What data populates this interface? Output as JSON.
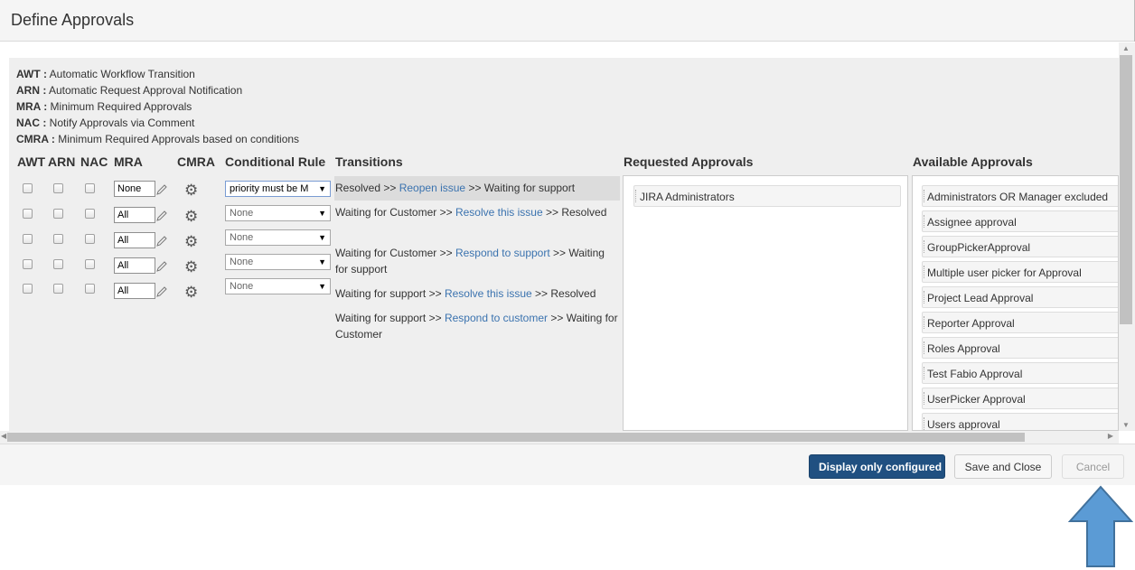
{
  "dialog": {
    "title": "Define Approvals"
  },
  "legend": [
    {
      "abbr": "AWT :",
      "text": " Automatic Workflow Transition"
    },
    {
      "abbr": "ARN :",
      "text": " Automatic Request Approval Notification"
    },
    {
      "abbr": "MRA :",
      "text": " Minimum Required Approvals"
    },
    {
      "abbr": "NAC :",
      "text": " Notify Approvals via Comment"
    },
    {
      "abbr": "CMRA :",
      "text": " Minimum Required Approvals based on conditions"
    }
  ],
  "columns": {
    "awt": "AWT",
    "arn": "ARN",
    "nac": "NAC",
    "mra": "MRA",
    "cmra": "CMRA",
    "conditional_rule": "Conditional Rule",
    "transitions": "Transitions",
    "requested": "Requested Approvals",
    "available": "Available Approvals"
  },
  "rows": [
    {
      "mra": "None",
      "rule": "priority must be M"
    },
    {
      "mra": "All",
      "rule": "None"
    },
    {
      "mra": "All",
      "rule": "None"
    },
    {
      "mra": "All",
      "rule": "None"
    },
    {
      "mra": "All",
      "rule": "None"
    }
  ],
  "transitions": [
    {
      "from": "Resolved >> ",
      "link": "Reopen issue",
      "to": " >> Waiting for support",
      "selected": true
    },
    {
      "from": "Waiting for Customer >> ",
      "link": "Resolve this issue",
      "to": " >> Resolved"
    },
    {
      "from": "Waiting for Customer >> ",
      "link": "Respond to support",
      "to": " >> Waiting for support"
    },
    {
      "from": "Waiting for support >> ",
      "link": "Resolve this issue",
      "to": " >> Resolved"
    },
    {
      "from": "Waiting for support >> ",
      "link": "Respond to customer",
      "to": " >> Waiting for Customer"
    }
  ],
  "requested_approvals": [
    "JIRA Administrators"
  ],
  "available_approvals": [
    "Administrators OR Manager excluded",
    "Assignee approval",
    "GroupPickerApproval",
    "Multiple user picker for Approval",
    "Project Lead Approval",
    "Reporter Approval",
    "Roles Approval",
    "Test Fabio Approval",
    "UserPicker Approval",
    "Users approval"
  ],
  "footer": {
    "display_configured": "Display only configured",
    "save_close": "Save and Close",
    "cancel": "Cancel"
  },
  "colors": {
    "primary": "#205081",
    "link": "#3b73af",
    "arrow": "#5b9bd5"
  },
  "icons": {
    "gear": "gear-icon",
    "pencil": "pencil-icon",
    "arrow": "up-arrow-annotation"
  }
}
